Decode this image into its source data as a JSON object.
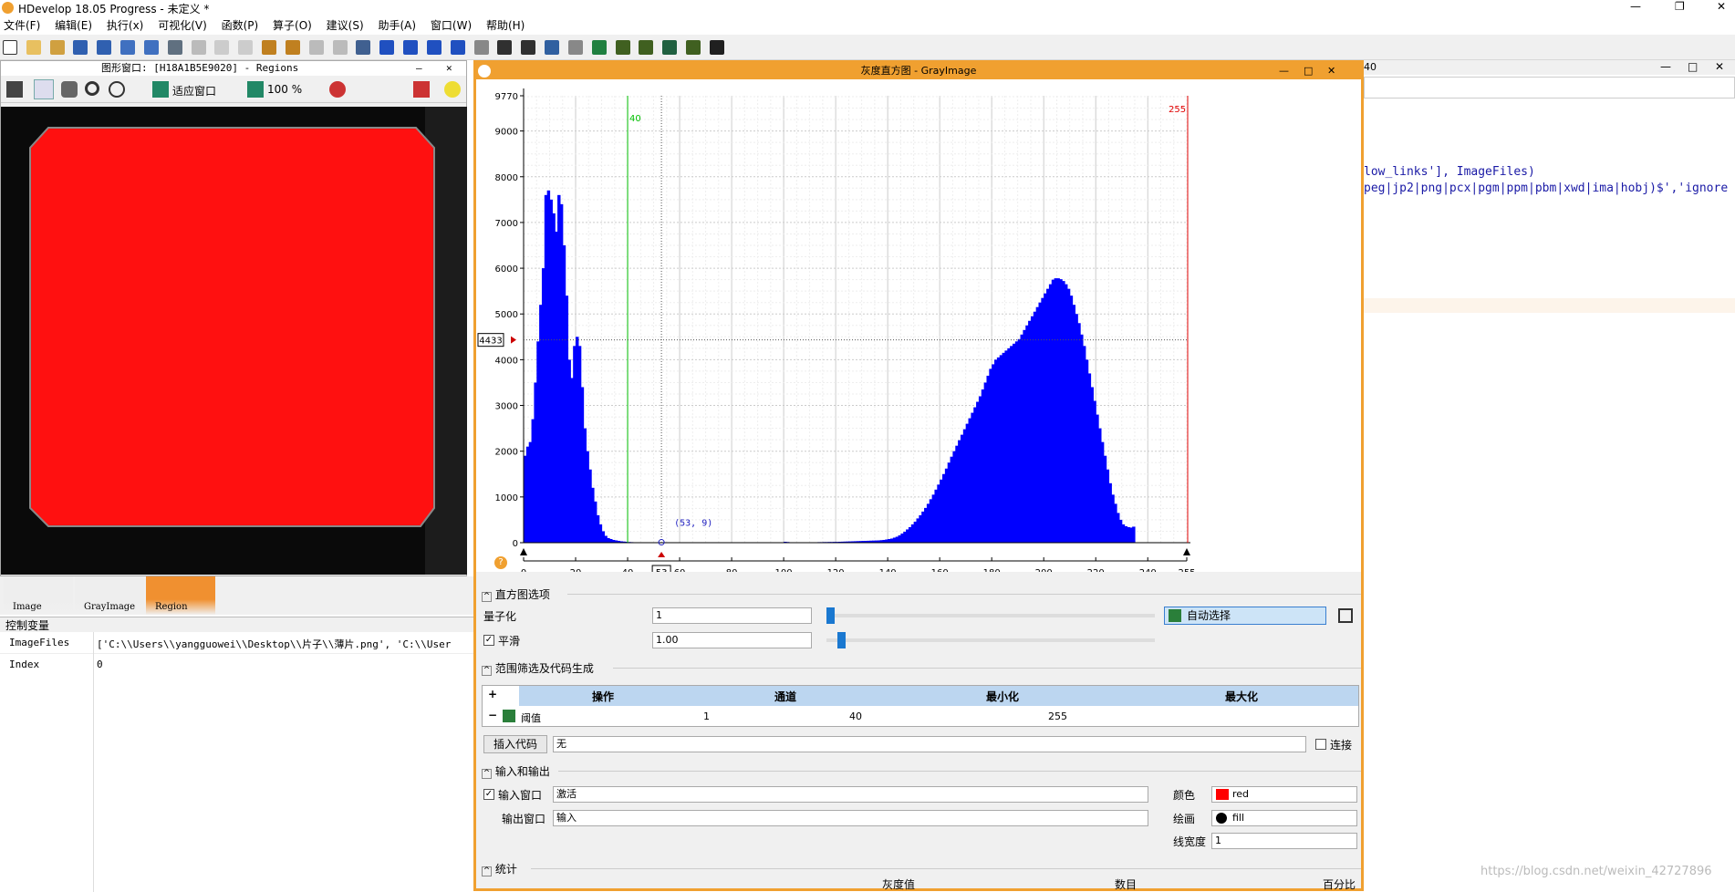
{
  "window": {
    "title": "HDevelop 18.05 Progress - 未定义 *",
    "win_min": "—",
    "win_max": "❐",
    "win_close": "✕"
  },
  "menu": [
    {
      "label": "文件(F)"
    },
    {
      "label": "编辑(E)"
    },
    {
      "label": "执行(x)"
    },
    {
      "label": "可视化(V)"
    },
    {
      "label": "函数(P)"
    },
    {
      "label": "算子(O)"
    },
    {
      "label": "建议(S)"
    },
    {
      "label": "助手(A)"
    },
    {
      "label": "窗口(W)"
    },
    {
      "label": "帮助(H)"
    }
  ],
  "graphics_window": {
    "title": "图形窗口: [H18A1B5E9020] - Regions",
    "fit_label": "适应窗口",
    "zoom_label": "100 %",
    "btn_min": "—",
    "btn_close": "✕"
  },
  "thumbnails": [
    {
      "label": "Image"
    },
    {
      "label": "GrayImage"
    },
    {
      "label": "Region"
    }
  ],
  "control_vars": {
    "title": "控制变量",
    "rows": [
      {
        "name": "ImageFiles",
        "value": "['C:\\\\Users\\\\yangguowei\\\\Desktop\\\\片子\\\\薄片.png', 'C:\\\\User"
      },
      {
        "name": "Index",
        "value": "0"
      }
    ]
  },
  "histogram_window": {
    "title": "灰度直方图 - GrayImage",
    "btn_min": "—",
    "btn_max": "□",
    "btn_close": "✕"
  },
  "chart_data": {
    "type": "bar",
    "title": "",
    "xlabel": "",
    "ylabel": "",
    "xlim": [
      0,
      255
    ],
    "ylim": [
      0,
      9770
    ],
    "x_ticks": [
      "0",
      "20",
      "40",
      "53",
      "60",
      "80",
      "100",
      "120",
      "140",
      "160",
      "180",
      "200",
      "220",
      "240",
      "255"
    ],
    "y_ticks": [
      "0",
      "1000",
      "2000",
      "3000",
      "4000",
      "5000",
      "6000",
      "7000",
      "8000",
      "9000",
      "9770"
    ],
    "cursor_y_label": "4433",
    "threshold_min_label": "40",
    "threshold_max_label": "255",
    "cursor_point_label": "(53, 9)",
    "bar_color": "#0000ff",
    "min_line_color": "#00c000",
    "max_line_color": "#e00000",
    "values": [
      1900,
      2100,
      2200,
      2700,
      3500,
      4400,
      5200,
      6000,
      7600,
      7700,
      7500,
      7200,
      6800,
      7600,
      7400,
      6500,
      5400,
      4000,
      3600,
      4300,
      4500,
      4300,
      3400,
      2500,
      2000,
      1600,
      1200,
      900,
      600,
      400,
      250,
      150,
      100,
      80,
      60,
      50,
      40,
      30,
      25,
      20,
      15,
      12,
      10,
      9,
      8,
      7,
      6,
      6,
      5,
      5,
      5,
      5,
      5,
      9,
      5,
      5,
      5,
      5,
      5,
      5,
      5,
      5,
      5,
      5,
      5,
      5,
      5,
      5,
      5,
      5,
      5,
      5,
      5,
      5,
      5,
      5,
      5,
      5,
      5,
      5,
      5,
      5,
      5,
      5,
      5,
      5,
      5,
      5,
      5,
      5,
      5,
      5,
      5,
      5,
      5,
      5,
      5,
      5,
      5,
      5,
      20,
      15,
      10,
      8,
      8,
      8,
      8,
      8,
      8,
      8,
      8,
      10,
      10,
      12,
      12,
      14,
      14,
      16,
      16,
      18,
      18,
      20,
      22,
      24,
      26,
      28,
      30,
      32,
      34,
      36,
      38,
      40,
      42,
      44,
      46,
      48,
      50,
      55,
      60,
      70,
      80,
      90,
      110,
      130,
      160,
      200,
      240,
      290,
      340,
      400,
      460,
      530,
      600,
      680,
      760,
      850,
      950,
      1050,
      1160,
      1270,
      1380,
      1500,
      1620,
      1750,
      1880,
      2000,
      2120,
      2240,
      2360,
      2480,
      2600,
      2720,
      2840,
      2960,
      3080,
      3200,
      3350,
      3500,
      3650,
      3800,
      3900,
      4000,
      4050,
      4100,
      4150,
      4200,
      4250,
      4300,
      4350,
      4400,
      4450,
      4550,
      4650,
      4750,
      4850,
      4950,
      5050,
      5150,
      5250,
      5350,
      5450,
      5550,
      5650,
      5750,
      5780,
      5780,
      5760,
      5720,
      5650,
      5550,
      5400,
      5200,
      5000,
      4800,
      4550,
      4300,
      4000,
      3700,
      3400,
      3100,
      2800,
      2500,
      2200,
      1900,
      1600,
      1300,
      1050,
      850,
      650,
      500,
      400,
      360,
      340,
      330,
      350
    ]
  },
  "hist_options": {
    "section_title": "直方图选项",
    "quantize_label": "量子化",
    "quantize_value": "1",
    "smooth_label": "平滑",
    "smooth_value": "1.00",
    "smooth_checked": "✓",
    "auto_select_label": "自动选择"
  },
  "range_section": {
    "title": "范围筛选及代码生成",
    "add_btn": "+",
    "remove_btn": "−",
    "headers": [
      "操作",
      "通道",
      "最小化",
      "最大化"
    ],
    "row": {
      "op": "阈值",
      "channel": "1",
      "min": "40",
      "max": "255"
    },
    "insert_code_label": "插入代码",
    "insert_value": "无",
    "connect_label": "连接"
  },
  "io_section": {
    "title": "输入和输出",
    "input_window_label": "输入窗口",
    "input_window_value": "激活",
    "input_checked": "✓",
    "output_window_label": "输出窗口",
    "output_window_value": "输入",
    "color_label": "颜色",
    "color_value": "red",
    "draw_label": "绘画",
    "draw_value": "fill",
    "linewidth_label": "线宽度",
    "linewidth_value": "1"
  },
  "stats_section": {
    "title": "统计",
    "headers": [
      "灰度值",
      "数目",
      "百分比"
    ]
  },
  "code_panel": {
    "title_suffix": "40",
    "line1": "low_links'], ImageFiles)",
    "line2": "peg|jp2|png|pcx|pgm|ppm|pbm|xwd|ima|hobj)$','ignore"
  },
  "watermark": "https://blog.csdn.net/weixin_42727896"
}
